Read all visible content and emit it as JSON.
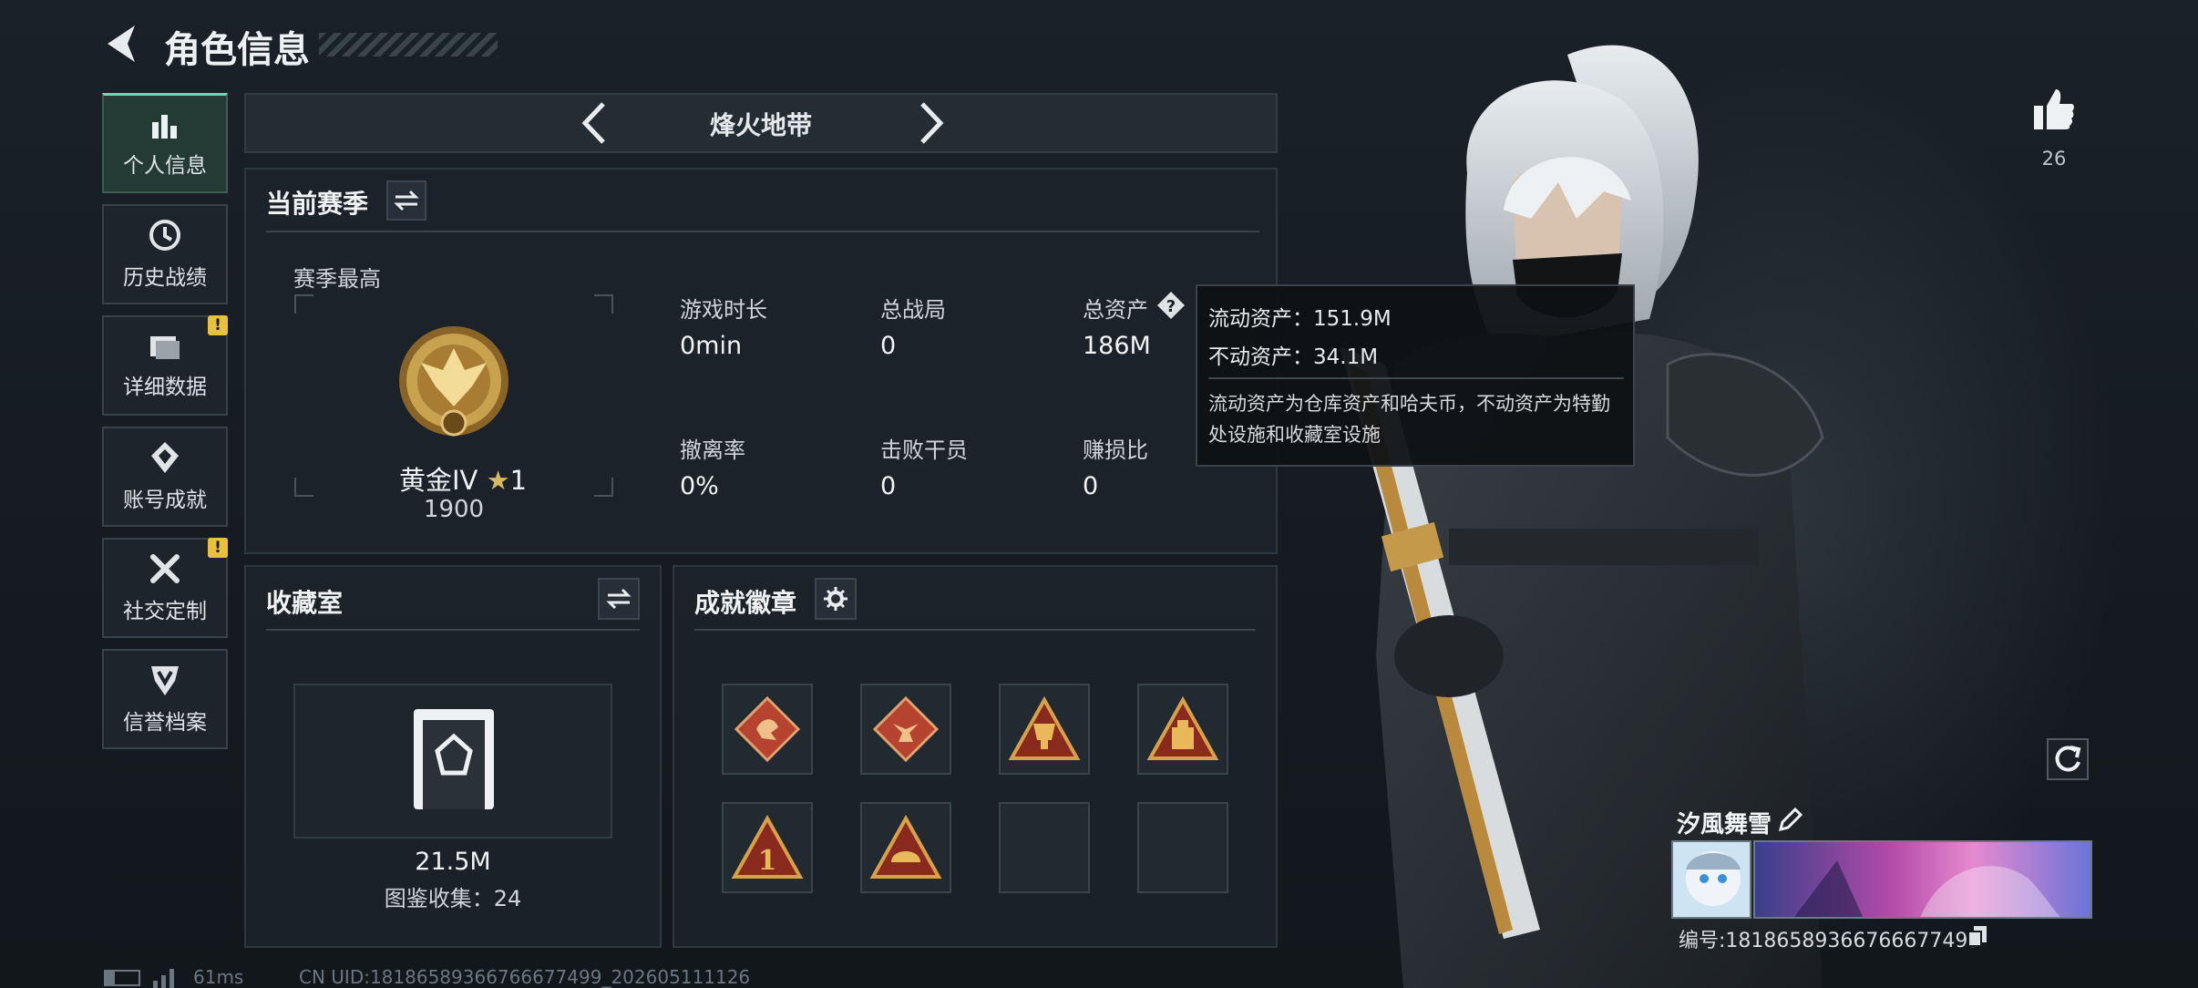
{
  "header": {
    "title": "角色信息"
  },
  "sidebar": {
    "items": [
      {
        "label": "个人信息",
        "icon": "bar-chart-icon",
        "active": true
      },
      {
        "label": "历史战绩",
        "icon": "history-clock-icon",
        "active": false
      },
      {
        "label": "详细数据",
        "icon": "folder-icon",
        "active": false,
        "alert": "!"
      },
      {
        "label": "账号成就",
        "icon": "achievement-icon",
        "active": false
      },
      {
        "label": "社交定制",
        "icon": "wrench-tools-icon",
        "active": false,
        "alert": "!"
      },
      {
        "label": "信誉档案",
        "icon": "credit-shield-icon",
        "active": false
      }
    ]
  },
  "mode_selector": {
    "label": "烽火地带"
  },
  "season": {
    "title": "当前赛季",
    "best_label": "赛季最高",
    "rank_name": "黄金IV",
    "rank_stars": "1",
    "rank_points": "1900",
    "stats": [
      {
        "label": "游戏时长",
        "value": "0min"
      },
      {
        "label": "总战局",
        "value": "0"
      },
      {
        "label": "总资产",
        "value": "186M"
      },
      {
        "label": "撤离率",
        "value": "0%"
      },
      {
        "label": "击败干员",
        "value": "0"
      },
      {
        "label": "赚损比",
        "value": "0"
      }
    ]
  },
  "tooltip": {
    "liquid": "流动资产：151.9M",
    "fixed": "不动资产：34.1M",
    "note": "流动资产为仓库资产和哈夫币，不动资产为特勤处设施和收藏室设施"
  },
  "collection": {
    "title": "收藏室",
    "value": "21.5M",
    "count": "图鉴收集：24"
  },
  "badges": {
    "title": "成就徽章",
    "items": [
      {
        "name": "dragon-badge",
        "color": "#b5432f"
      },
      {
        "name": "beast-badge",
        "color": "#b5432f"
      },
      {
        "name": "trophy-badge",
        "color": "#c8922e"
      },
      {
        "name": "crate-badge",
        "color": "#c8922e"
      },
      {
        "name": "number-one-badge",
        "color": "#c8922e"
      },
      {
        "name": "helmet-badge",
        "color": "#c8922e"
      }
    ]
  },
  "like": {
    "count": "26"
  },
  "profile": {
    "name": "汐風舞雪",
    "id": "编号:18186589366766677499"
  },
  "footer": {
    "ping": "61ms",
    "uid": "CN UID:18186589366766677499_202605111126"
  },
  "colors": {
    "accent": "#5ee0b8",
    "warning": "#e8c23a",
    "gold": "#c8a24e"
  }
}
